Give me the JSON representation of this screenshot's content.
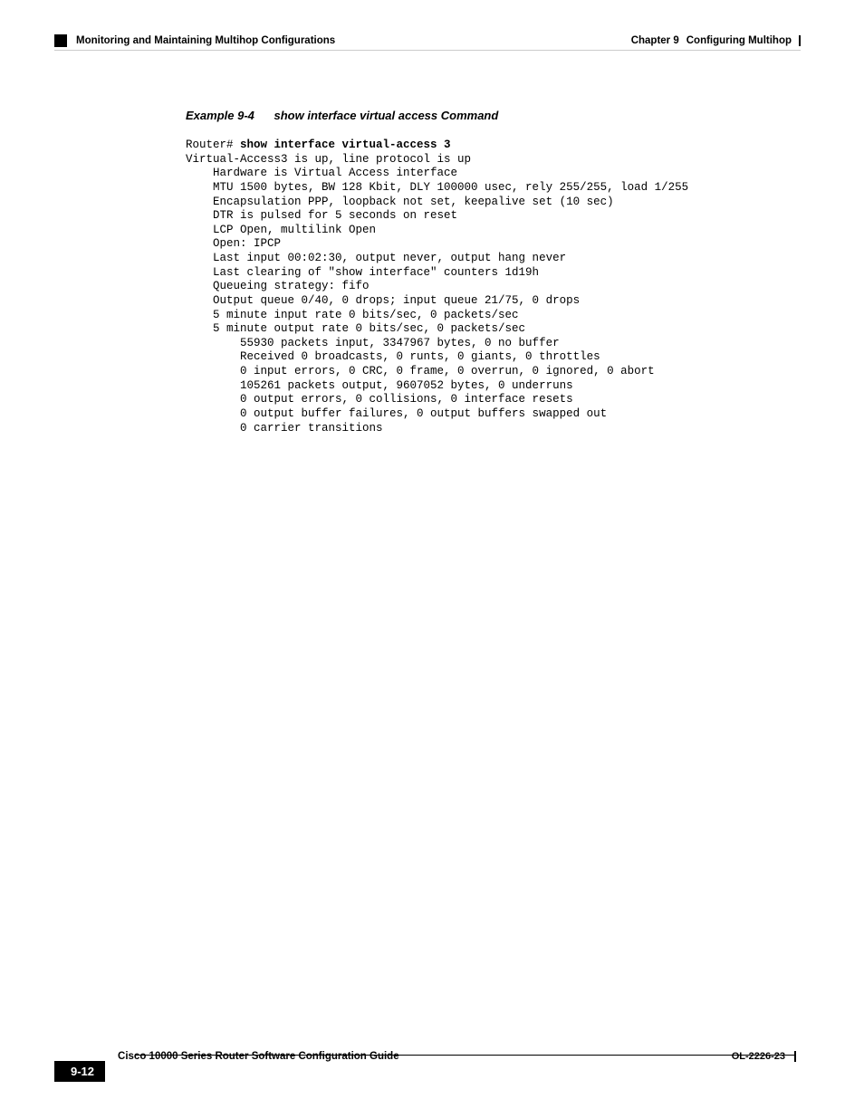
{
  "header": {
    "chapter": "Chapter 9",
    "chapterTitle": "Configuring Multihop",
    "section": "Monitoring and Maintaining Multihop Configurations"
  },
  "example": {
    "label": "Example 9-4",
    "title": "show interface virtual access Command",
    "prompt": "Router# ",
    "command": "show interface virtual-access 3",
    "output": "Virtual-Access3 is up, line protocol is up\n    Hardware is Virtual Access interface\n    MTU 1500 bytes, BW 128 Kbit, DLY 100000 usec, rely 255/255, load 1/255\n    Encapsulation PPP, loopback not set, keepalive set (10 sec)\n    DTR is pulsed for 5 seconds on reset\n    LCP Open, multilink Open\n    Open: IPCP\n    Last input 00:02:30, output never, output hang never\n    Last clearing of \"show interface\" counters 1d19h\n    Queueing strategy: fifo\n    Output queue 0/40, 0 drops; input queue 21/75, 0 drops\n    5 minute input rate 0 bits/sec, 0 packets/sec\n    5 minute output rate 0 bits/sec, 0 packets/sec\n        55930 packets input, 3347967 bytes, 0 no buffer\n        Received 0 broadcasts, 0 runts, 0 giants, 0 throttles\n        0 input errors, 0 CRC, 0 frame, 0 overrun, 0 ignored, 0 abort\n        105261 packets output, 9607052 bytes, 0 underruns\n        0 output errors, 0 collisions, 0 interface resets\n        0 output buffer failures, 0 output buffers swapped out\n        0 carrier transitions"
  },
  "footer": {
    "guide": "Cisco 10000 Series Router Software Configuration Guide",
    "page": "9-12",
    "docCode": "OL-2226-23"
  }
}
